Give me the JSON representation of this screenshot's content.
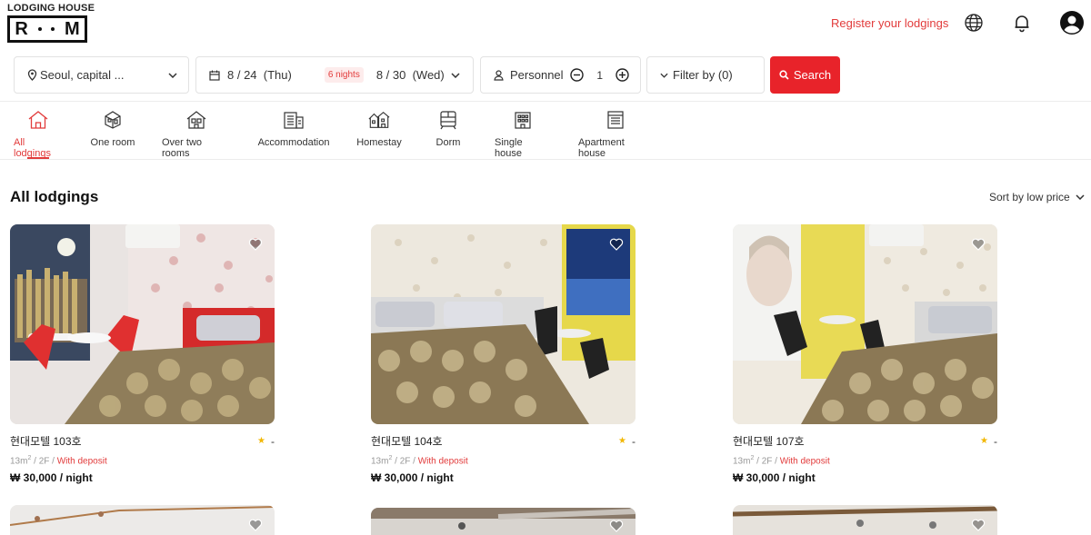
{
  "header": {
    "logo_top": "LODGING HOUSE",
    "logo_letters": [
      "R",
      "M"
    ],
    "register_label": "Register your lodgings",
    "icons": [
      "globe-icon",
      "bell-icon",
      "user-icon"
    ]
  },
  "search": {
    "location": "Seoul, capital ...",
    "checkin": "8 / 24  (Thu)",
    "nights": "6 nights",
    "checkout": "8 / 30  (Wed)",
    "personnel_label": "Personnel",
    "personnel_count": "1",
    "filter_label": "Filter by (0)",
    "search_label": "Search"
  },
  "categories": [
    {
      "label": "All lodgings",
      "icon": "home-icon"
    },
    {
      "label": "One room",
      "icon": "cube-house-icon"
    },
    {
      "label": "Over two rooms",
      "icon": "house-rooms-icon"
    },
    {
      "label": "Accommodation",
      "icon": "building-icon"
    },
    {
      "label": "Homestay",
      "icon": "homestay-icon"
    },
    {
      "label": "Dorm",
      "icon": "dorm-icon"
    },
    {
      "label": "Single house",
      "icon": "single-house-icon"
    },
    {
      "label": "Apartment house",
      "icon": "apartment-icon"
    }
  ],
  "section": {
    "title": "All lodgings",
    "sort_label": "Sort by low price"
  },
  "listings": [
    {
      "name": "현대모텔 103호",
      "rating": "-",
      "area": "13m",
      "sup": "2",
      "floor": " / 2F / ",
      "deposit": "With deposit",
      "price": "₩ 30,000 / night"
    },
    {
      "name": "현대모텔 104호",
      "rating": "-",
      "area": "13m",
      "sup": "2",
      "floor": " / 2F / ",
      "deposit": "With deposit",
      "price": "₩ 30,000 / night"
    },
    {
      "name": "현대모텔 107호",
      "rating": "-",
      "area": "13m",
      "sup": "2",
      "floor": " / 2F / ",
      "deposit": "With deposit",
      "price": "₩ 30,000 / night"
    }
  ],
  "colors": {
    "accent": "#e8232a",
    "star": "#f2b700"
  }
}
